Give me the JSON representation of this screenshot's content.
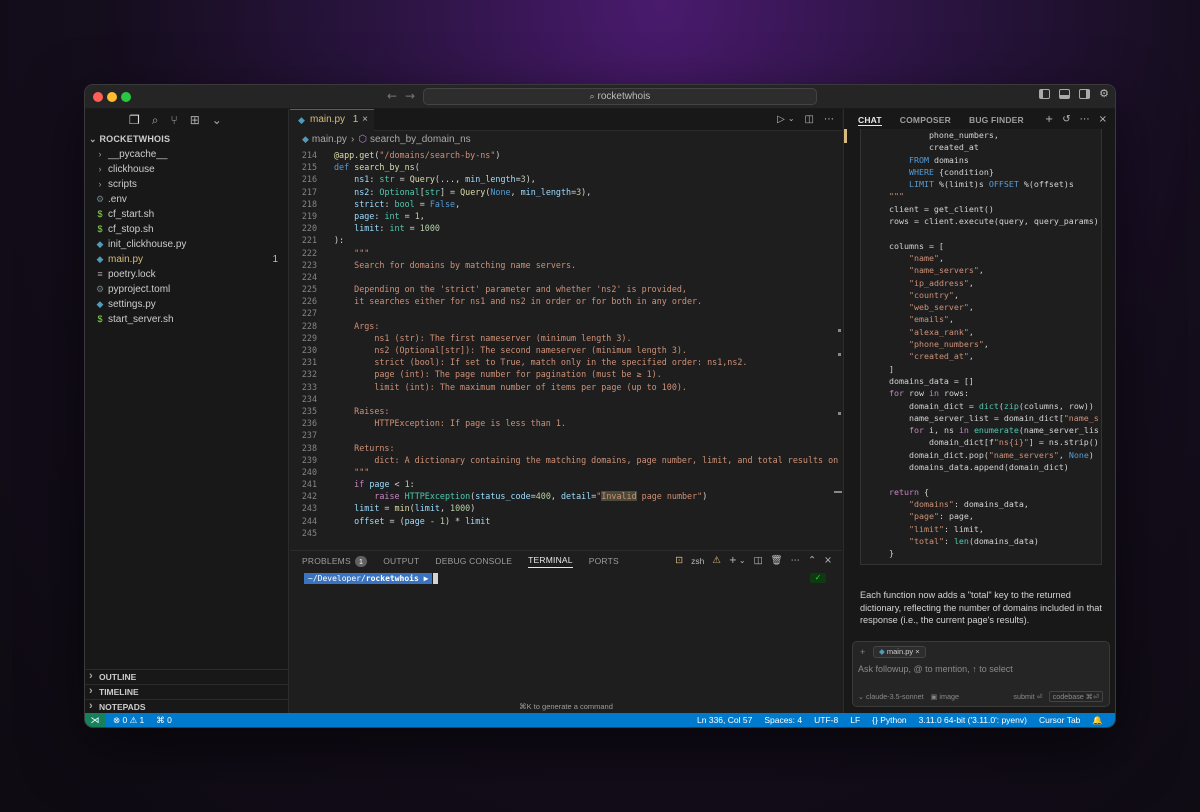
{
  "window": {
    "search_text": "rocketwhois"
  },
  "sidebar": {
    "root_label": "ROCKETWHOIS",
    "files": [
      {
        "icon": "folder",
        "name": "__pycache__"
      },
      {
        "icon": "folder",
        "name": "clickhouse"
      },
      {
        "icon": "folder",
        "name": "scripts"
      },
      {
        "icon": "gear",
        "name": ".env"
      },
      {
        "icon": "sh",
        "name": "cf_start.sh"
      },
      {
        "icon": "sh",
        "name": "cf_stop.sh"
      },
      {
        "icon": "py",
        "name": "init_clickhouse.py"
      },
      {
        "icon": "py",
        "name": "main.py",
        "badge": "1",
        "modified": true
      },
      {
        "icon": "lines",
        "name": "poetry.lock"
      },
      {
        "icon": "gear",
        "name": "pyproject.toml"
      },
      {
        "icon": "py",
        "name": "settings.py"
      },
      {
        "icon": "sh",
        "name": "start_server.sh"
      }
    ],
    "sections": [
      "OUTLINE",
      "TIMELINE",
      "NOTEPADS"
    ]
  },
  "editor": {
    "tab_name": "main.py",
    "tab_problems": "1",
    "breadcrumb_file": "main.py",
    "breadcrumb_symbol": "search_by_domain_ns",
    "lines": [
      {
        "n": "214",
        "html": "<span class=\"dec\">@app.get</span>(<span class=\"str\">\"/domains/search-by-ns\"</span>)"
      },
      {
        "n": "215",
        "html": "<span class=\"kw\">def</span> <span class=\"fn\">search_by_ns</span>("
      },
      {
        "n": "216",
        "html": "    <span class=\"var\">ns1</span>: <span class=\"ty\">str</span> = <span class=\"fn\">Query</span>(..., <span class=\"var\">min_length</span>=<span class=\"num\">3</span>),"
      },
      {
        "n": "217",
        "html": "    <span class=\"var\">ns2</span>: <span class=\"ty\">Optional</span>[<span class=\"ty\">str</span>] = <span class=\"fn\">Query</span>(<span class=\"kw\">None</span>, <span class=\"var\">min_length</span>=<span class=\"num\">3</span>),"
      },
      {
        "n": "218",
        "html": "    <span class=\"var\">strict</span>: <span class=\"ty\">bool</span> = <span class=\"kw\">False</span>,"
      },
      {
        "n": "219",
        "html": "    <span class=\"var\">page</span>: <span class=\"ty\">int</span> = <span class=\"num\">1</span>,"
      },
      {
        "n": "220",
        "html": "    <span class=\"var\">limit</span>: <span class=\"ty\">int</span> = <span class=\"num\">1000</span>"
      },
      {
        "n": "221",
        "html": "):"
      },
      {
        "n": "222",
        "html": "    <span class=\"cm\">\"\"\"</span>"
      },
      {
        "n": "223",
        "html": "    <span class=\"cm\">Search for domains by matching name servers.</span>"
      },
      {
        "n": "224",
        "html": ""
      },
      {
        "n": "225",
        "html": "    <span class=\"cm\">Depending on the 'strict' parameter and whether 'ns2' is provided,</span>"
      },
      {
        "n": "226",
        "html": "    <span class=\"cm\">it searches either for ns1 and ns2 in order or for both in any order.</span>"
      },
      {
        "n": "227",
        "html": ""
      },
      {
        "n": "228",
        "html": "    <span class=\"cm\">Args:</span>"
      },
      {
        "n": "229",
        "html": "        <span class=\"cm\">ns1 (str): The first nameserver (minimum length 3).</span>"
      },
      {
        "n": "230",
        "html": "        <span class=\"cm\">ns2 (Optional[str]): The second nameserver (minimum length 3).</span>"
      },
      {
        "n": "231",
        "html": "        <span class=\"cm\">strict (bool): If set to True, match only in the specified order: ns1,ns2.</span>"
      },
      {
        "n": "232",
        "html": "        <span class=\"cm\">page (int): The page number for pagination (must be ≥ 1).</span>"
      },
      {
        "n": "233",
        "html": "        <span class=\"cm\">limit (int): The maximum number of items per page (up to 100).</span>"
      },
      {
        "n": "234",
        "html": ""
      },
      {
        "n": "235",
        "html": "    <span class=\"cm\">Raises:</span>"
      },
      {
        "n": "236",
        "html": "        <span class=\"cm\">HTTPException: If page is less than 1.</span>"
      },
      {
        "n": "237",
        "html": ""
      },
      {
        "n": "238",
        "html": "    <span class=\"cm\">Returns:</span>"
      },
      {
        "n": "239",
        "html": "        <span class=\"cm\">dict: A dictionary containing the matching domains, page number, limit, and total results on the</span>"
      },
      {
        "n": "240",
        "html": "    <span class=\"cm\">\"\"\"</span>"
      },
      {
        "n": "241",
        "html": "    <span class=\"kw2\">if</span> <span class=\"var\">page</span> &lt; <span class=\"num\">1</span>:"
      },
      {
        "n": "242",
        "html": "        <span class=\"kw2\">raise</span> <span class=\"ty\">HTTPException</span>(<span class=\"var\">status_code</span>=<span class=\"num\">400</span>, <span class=\"var\">detail</span>=<span class=\"str\">\"<span class=\"hl\">Invalid</span> page number\"</span>)"
      },
      {
        "n": "243",
        "html": "    <span class=\"var\">limit</span> = <span class=\"fn\">min</span>(<span class=\"var\">limit</span>, <span class=\"num\">1000</span>)"
      },
      {
        "n": "244",
        "html": "    <span class=\"var\">offset</span> = (<span class=\"var\">page</span> - <span class=\"num\">1</span>) * <span class=\"var\">limit</span>"
      },
      {
        "n": "245",
        "html": ""
      }
    ]
  },
  "panel": {
    "tabs": [
      "PROBLEMS",
      "OUTPUT",
      "DEBUG CONSOLE",
      "TERMINAL",
      "PORTS"
    ],
    "problems_count": "1",
    "active_tab": "TERMINAL",
    "shell_label": "zsh",
    "prompt_path": "~/Developer/",
    "prompt_dir": "rocketwhois",
    "hint": "⌘K to generate a command"
  },
  "chat": {
    "tabs": [
      "CHAT",
      "COMPOSER",
      "BUG FINDER"
    ],
    "code_lines": [
      "            phone_numbers,",
      "            created_at",
      "        FROM domains",
      "        WHERE {condition}",
      "        LIMIT %(limit)s OFFSET %(offset)s",
      "    \"\"\"",
      "    client = get_client()",
      "    rows = client.execute(query, query_params)",
      "",
      "    columns = [",
      "        \"name\",",
      "        \"name_servers\",",
      "        \"ip_address\",",
      "        \"country\",",
      "        \"web_server\",",
      "        \"emails\",",
      "        \"alexa_rank\",",
      "        \"phone_numbers\",",
      "        \"created_at\",",
      "    ]",
      "    domains_data = []",
      "    for row in rows:",
      "        domain_dict = dict(zip(columns, row))",
      "        name_server_list = domain_dict[\"name_s",
      "        for i, ns in enumerate(name_server_lis",
      "            domain_dict[f\"ns{i}\"] = ns.strip()",
      "        domain_dict.pop(\"name_servers\", None)",
      "        domains_data.append(domain_dict)",
      "",
      "    return {",
      "        \"domains\": domains_data,",
      "        \"page\": page,",
      "        \"limit\": limit,",
      "        \"total\": len(domains_data)",
      "    }"
    ],
    "message": "Each function now adds a \"total\" key to the returned dictionary, reflecting the number of domains included in that response (i.e., the current page's results).",
    "context_chip": "main.py",
    "input_placeholder": "Ask followup, @ to mention, ↑ to select",
    "model": "claude-3.5-sonnet",
    "image_label": "image",
    "submit_label": "submit ⏎",
    "codebase_label": "codebase ⌘⏎"
  },
  "statusbar": {
    "problems": "⊗ 0 ⚠ 1",
    "ports": "⌘ 0",
    "position": "Ln 336, Col 57",
    "spaces": "Spaces: 4",
    "encoding": "UTF-8",
    "eol": "LF",
    "language": "{} Python",
    "interpreter": "3.11.0 64-bit ('3.11.0': pyenv)",
    "cursor_tab": "Cursor Tab"
  }
}
